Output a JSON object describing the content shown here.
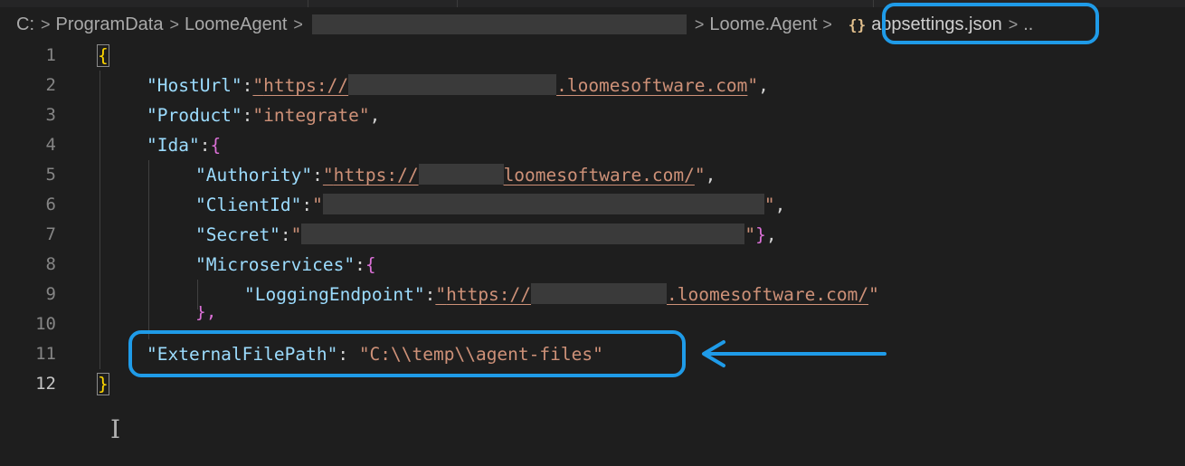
{
  "breadcrumb": {
    "items": [
      "C:",
      "ProgramData",
      "LoomeAgent",
      "Loome.Agent"
    ],
    "file_icon": "{}",
    "file_name": "appsettings.json",
    "ellipsis": ".."
  },
  "line_numbers": [
    "1",
    "2",
    "3",
    "4",
    "5",
    "6",
    "7",
    "8",
    "9",
    "10",
    "11",
    "12"
  ],
  "code": {
    "host_url_key": "\"HostUrl\"",
    "host_url_prefix": "https://",
    "host_url_suffix": ".loomesoftware.com",
    "product_key": "\"Product\"",
    "product_value": "\"integrate\"",
    "ida_key": "\"Ida\"",
    "authority_key": "\"Authority\"",
    "authority_prefix": "https://",
    "authority_suffix": "loomesoftware.com/",
    "clientid_key": "\"ClientId\"",
    "secret_key": "\"Secret\"",
    "microservices_key": "\"Microservices\"",
    "logging_key": "\"LoggingEndpoint\"",
    "logging_prefix": "https://",
    "logging_suffix": ".loomesoftware.com/",
    "external_key": "\"ExternalFilePath\"",
    "external_value": "\"C:\\\\temp\\\\agent-files\""
  },
  "colors": {
    "highlight": "#1f9be8",
    "background": "#1e1e1e",
    "string": "#ce9178",
    "key": "#9cdcfe"
  },
  "icons": {
    "arrow": "left-arrow-icon",
    "cursor": "text-cursor-icon",
    "file": "json-braces-icon"
  }
}
